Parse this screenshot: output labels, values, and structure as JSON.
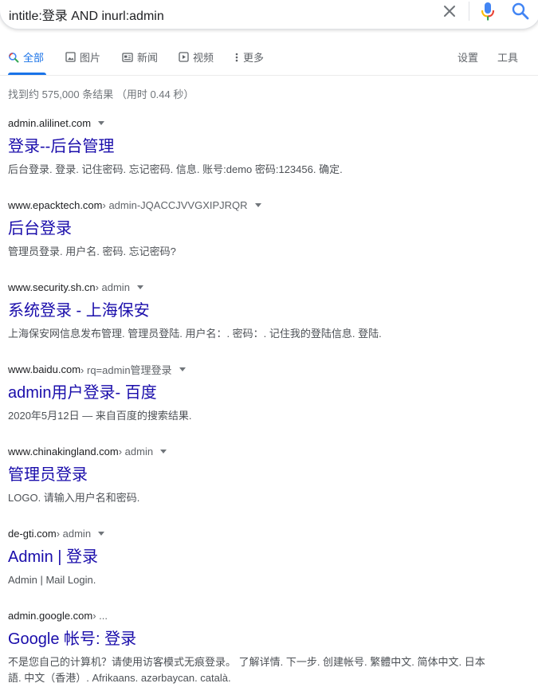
{
  "search": {
    "query": "intitle:登录 AND inurl:admin"
  },
  "tabs": [
    {
      "label": "全部",
      "icon": "search-icon",
      "active": true
    },
    {
      "label": "图片",
      "icon": "image-icon"
    },
    {
      "label": "新闻",
      "icon": "news-icon"
    },
    {
      "label": "视频",
      "icon": "video-icon"
    },
    {
      "label": "更多",
      "icon": "more-vert-icon"
    }
  ],
  "tools": {
    "settings": "设置",
    "tools": "工具"
  },
  "stats": "找到约 575,000 条结果 （用时 0.44 秒）",
  "colors": {
    "link": "#1a0dab",
    "accent": "#1a73e8",
    "snippet": "#4d5156",
    "meta": "#70757a"
  },
  "results": [
    {
      "domain": "admin.alilinet.com",
      "path": "",
      "title": "登录--后台管理",
      "snippet": "后台登录. 登录. 记住密码. 忘记密码. 信息. 账号:demo 密码:123456. 确定."
    },
    {
      "domain": "www.epacktech.com",
      "path": " › admin-JQACCJVVGXIPJRQR",
      "title": "后台登录",
      "snippet": "管理员登录. 用户名. 密码. 忘记密码?"
    },
    {
      "domain": "www.security.sh.cn",
      "path": " › admin",
      "title": "系统登录 - 上海保安",
      "snippet": "上海保安网信息发布管理. 管理员登陆. 用户名：. 密码：. 记住我的登陆信息. 登陆."
    },
    {
      "domain": "www.baidu.com",
      "path": " › rq=admin管理登录",
      "title": "admin用户登录- 百度",
      "snippet": "2020年5月12日 — 来自百度的搜索结果."
    },
    {
      "domain": "www.chinakingland.com",
      "path": " › admin",
      "title": "管理员登录",
      "snippet": "LOGO. 请输入用户名和密码."
    },
    {
      "domain": "de-gti.com",
      "path": " › admin",
      "title": "Admin | 登录",
      "snippet": "Admin | Mail Login."
    },
    {
      "domain": "admin.google.com",
      "path": " › ...",
      "title": "Google 帐号: 登录",
      "snippet": "不是您自己的计算机？请使用访客模式无痕登录。 了解详情. 下一步. 创建帐号. 繁體中文. 简体中文. 日本語. 中文（香港）. Afrikaans. azərbaycan. català."
    }
  ]
}
